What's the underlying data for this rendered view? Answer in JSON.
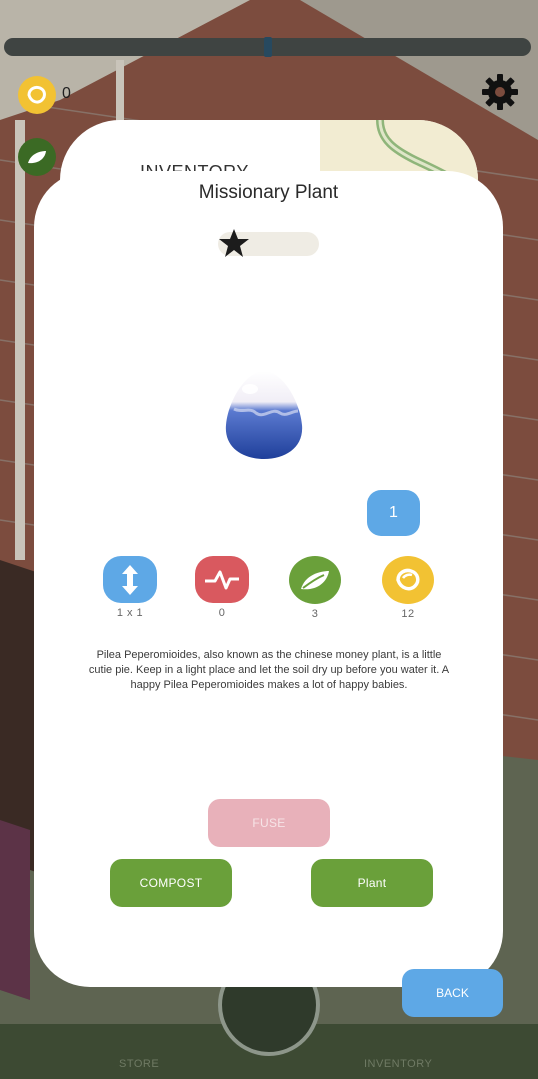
{
  "top_resources": [
    {
      "icon": "acorn-icon",
      "value": "0"
    },
    {
      "icon": "leaf-icon",
      "value": ""
    }
  ],
  "inventory_panel": {
    "title": "INVENTORY"
  },
  "plant_card": {
    "name": "Missionary Plant",
    "quantity": "1",
    "stats": [
      {
        "icon": "size-arrows-icon",
        "value": "1 x 1",
        "color": "#5ea8e6"
      },
      {
        "icon": "pulse-icon",
        "value": "0",
        "color": "#d9595f"
      },
      {
        "icon": "leaf-icon",
        "value": "3",
        "color": "#6aa03a"
      },
      {
        "icon": "acorn-icon",
        "value": "12",
        "color": "#f2c233"
      }
    ],
    "description": "Pilea Peperomioides, also known as the chinese money plant, is a little cutie pie. Keep in a light place and let the soil dry up before you water it. A happy Pilea Peperomioides makes a lot of happy babies.",
    "buttons": {
      "fuse": "FUSE",
      "compost": "COMPOST",
      "plant": "Plant"
    }
  },
  "back_button": "BACK",
  "bottom_nav": {
    "store": "STORE",
    "inventory": "INVENTORY"
  },
  "colors": {
    "blue": "#5ea8e6",
    "green": "#6aa03a",
    "pink": "#e8b1ba",
    "yellow": "#f2c233",
    "red": "#d9595f"
  }
}
